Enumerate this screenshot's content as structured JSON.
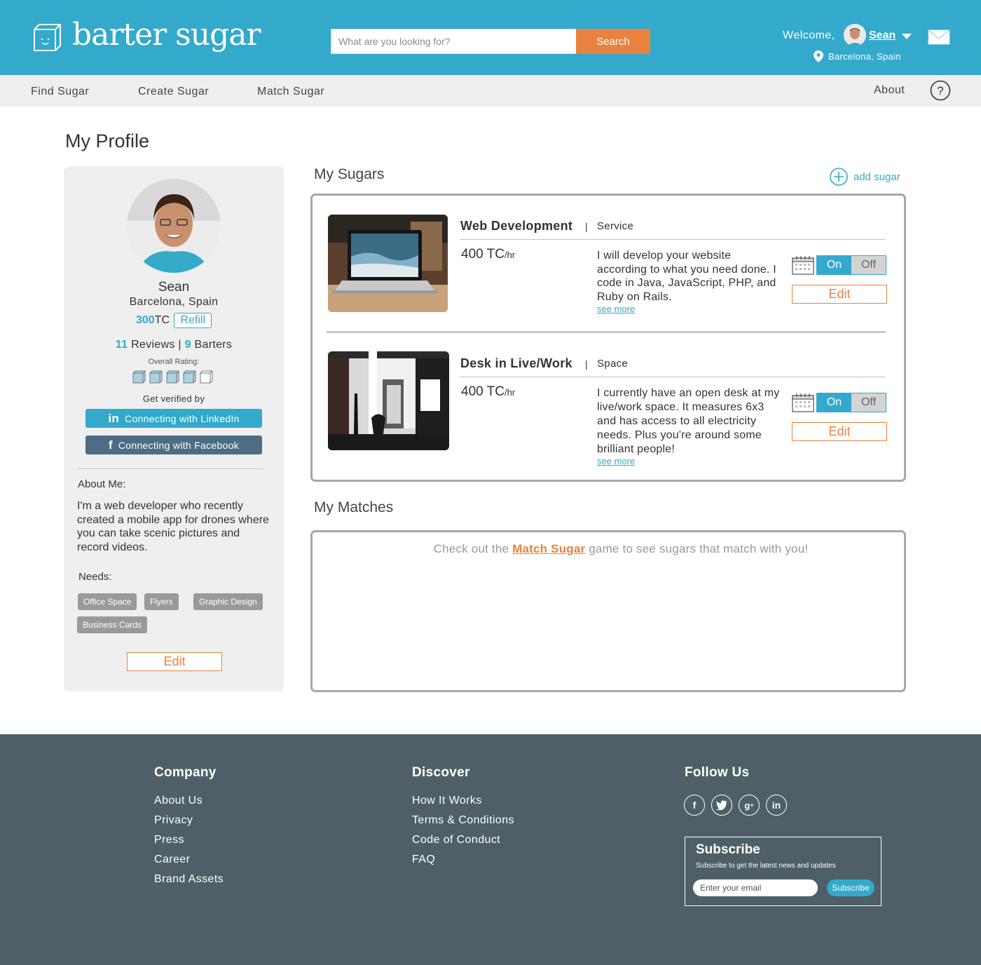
{
  "header": {
    "logo_text": "barter sugar",
    "search": {
      "placeholder": "What are you looking for?",
      "button": "Search"
    },
    "welcome": "Welcome,",
    "user_name": "Sean",
    "location": "Barcelona, Spain"
  },
  "nav": {
    "items": [
      "Find Sugar",
      "Create Sugar",
      "Match Sugar"
    ],
    "about": "About"
  },
  "page_title": "My Profile",
  "profile": {
    "name": "Sean",
    "location": "Barcelona, Spain",
    "tc_amount": "300",
    "tc_unit": "TC",
    "refill": "Refill",
    "reviews_count": "11",
    "reviews_label": "Reviews |",
    "barters_count": "9",
    "barters_label": "Barters",
    "rating_label": "Overall Rating:",
    "rating": 4,
    "rating_max": 5,
    "verify_label": "Get verified by",
    "linkedin": "Connecting with LinkedIn",
    "facebook": "Connecting with Facebook",
    "about_label": "About Me:",
    "about_text": "I'm a web developer who recently created a mobile app for drones where you can take scenic pictures and record videos.",
    "needs_label": "Needs:",
    "needs": [
      "Office Space",
      "Flyers",
      "Graphic Design",
      "Business Cards"
    ],
    "edit": "Edit"
  },
  "sugars": {
    "title": "My Sugars",
    "add": "add sugar",
    "items": [
      {
        "title": "Web Development",
        "separator": "|",
        "type": "Service",
        "price": "400 TC",
        "unit": "/hr",
        "description": "I will develop your website according to what you need done. I code in Java, JavaScript, PHP, and Ruby on Rails.",
        "see_more": "see more",
        "on": "On",
        "off": "Off",
        "edit": "Edit"
      },
      {
        "title": "Desk in Live/Work",
        "separator": "|",
        "type": "Space",
        "price": "400 TC",
        "unit": "/hr",
        "description": "I currently have an open desk at my live/work space. It measures 6x3 and has access to all electricity needs. Plus you're around some brilliant people!",
        "see_more": "see more",
        "on": "On",
        "off": "Off",
        "edit": "Edit"
      }
    ]
  },
  "matches": {
    "title": "My Matches",
    "msg_before": "Check out the ",
    "msg_link": "Match Sugar",
    "msg_after": " game to see sugars that match with you!"
  },
  "footer": {
    "company": {
      "title": "Company",
      "links": [
        "About Us",
        "Privacy",
        "Press",
        "Career",
        "Brand Assets"
      ]
    },
    "discover": {
      "title": "Discover",
      "links": [
        "How It Works",
        "Terms & Conditions",
        "Code of Conduct",
        "FAQ"
      ]
    },
    "follow": {
      "title": "Follow Us",
      "icons": [
        "facebook-icon",
        "twitter-icon",
        "google-plus-icon",
        "linkedin-icon"
      ]
    },
    "subscribe": {
      "title": "Subscribe",
      "text": "Subscribe to get the latest news and updates",
      "placeholder": "Enter your email",
      "button": "Subscribe"
    }
  },
  "colors": {
    "brand": "#33a9cc",
    "accent": "#e8823e",
    "footer": "#4e5f67"
  }
}
